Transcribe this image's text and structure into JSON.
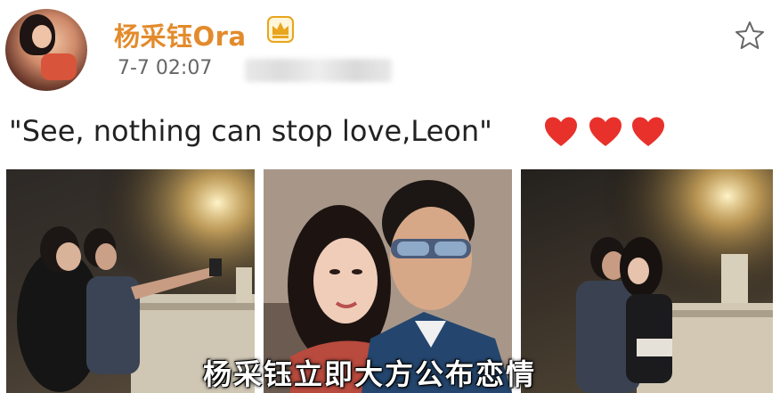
{
  "post": {
    "author": "杨采钰Ora",
    "timestamp": "7-7 02:07",
    "text": "\"See, nothing can stop love,Leon\""
  },
  "hearts": [
    "heart-icon",
    "heart-icon",
    "heart-icon"
  ],
  "photos": [
    {
      "name": "photo-1"
    },
    {
      "name": "photo-2"
    },
    {
      "name": "photo-3"
    }
  ],
  "caption": "杨采钰立即大方公布恋情",
  "icons": {
    "verified": "crown-icon",
    "favorite": "star-icon"
  },
  "colors": {
    "username": "#e38b2c",
    "heart": "#e8312b",
    "crown": "#e8a51d"
  }
}
